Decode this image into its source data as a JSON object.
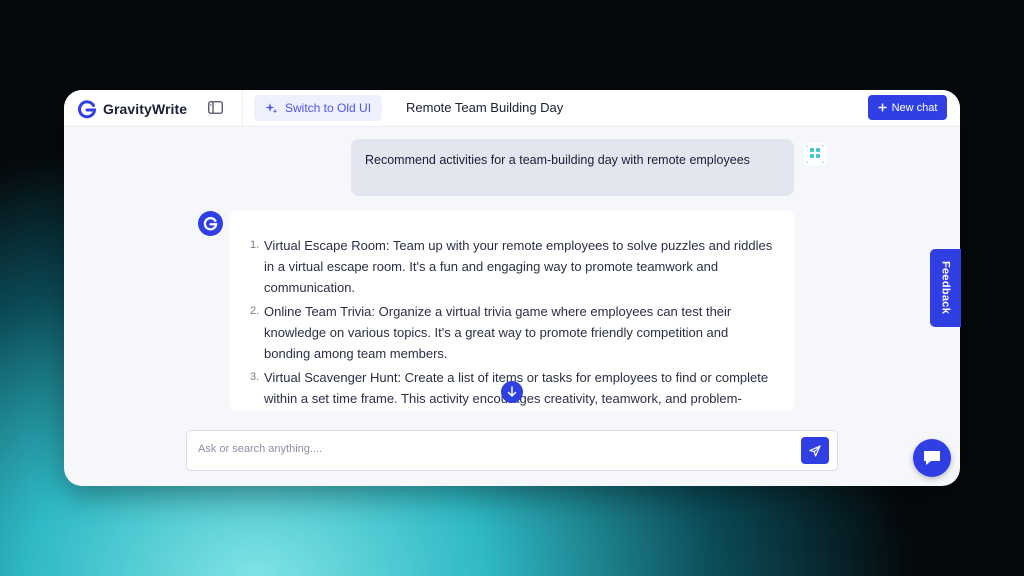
{
  "header": {
    "brand": "GravityWrite",
    "switch_label": "Switch to Old UI",
    "chat_title": "Remote Team Building Day",
    "new_chat_label": "New chat"
  },
  "conversation": {
    "user_message": "Recommend activities for a team-building day with remote employees",
    "bot_items": [
      {
        "num": "1.",
        "text": "Virtual Escape Room: Team up with your remote employees to solve puzzles and riddles in a virtual escape room. It's a fun and engaging way to promote teamwork and communication."
      },
      {
        "num": "2.",
        "text": "Online Team Trivia: Organize a virtual trivia game where employees can test their knowledge on various topics. It's a great way to promote friendly competition and bonding among team members."
      },
      {
        "num": "3.",
        "text": "Virtual Scavenger Hunt: Create a list of items or tasks for employees to find or complete within a set time frame. This activity encourages creativity, teamwork, and problem-solving skills."
      }
    ]
  },
  "composer": {
    "placeholder": "Ask or search anything...."
  },
  "feedback": {
    "label": "Feedback"
  },
  "colors": {
    "accent": "#2f3fe3",
    "accent_soft": "#eef0fe",
    "user_bubble": "#e3e6ef"
  },
  "icons": [
    "gravitywrite-logo-icon",
    "sidebar-toggle-icon",
    "sparkle-icon",
    "plus-icon",
    "user-avatar-icon",
    "bot-avatar-icon",
    "arrow-down-icon",
    "send-icon",
    "chat-bubble-icon"
  ]
}
